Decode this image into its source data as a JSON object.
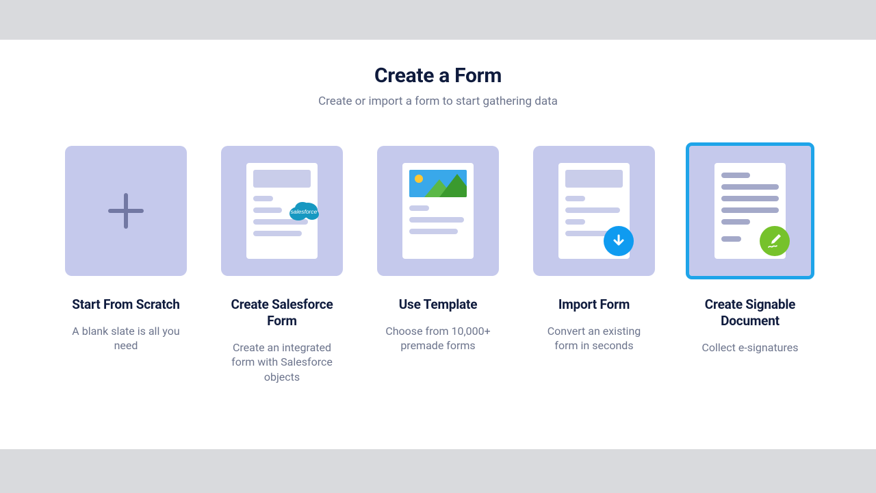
{
  "header": {
    "title": "Create a Form",
    "subtitle": "Create or import a form to start gathering data"
  },
  "options": [
    {
      "key": "scratch",
      "title": "Start From Scratch",
      "description": "A blank slate is all you need",
      "icon": "plus-icon",
      "selected": false
    },
    {
      "key": "salesforce",
      "title": "Create Salesforce Form",
      "description": "Create an integrated form with Salesforce objects",
      "icon": "salesforce-icon",
      "badge_text": "salesforce",
      "selected": false
    },
    {
      "key": "template",
      "title": "Use Template",
      "description": "Choose from 10,000+ premade forms",
      "icon": "image-icon",
      "selected": false
    },
    {
      "key": "import",
      "title": "Import Form",
      "description": "Convert an existing form in seconds",
      "icon": "download-arrow-icon",
      "selected": false
    },
    {
      "key": "signable",
      "title": "Create Signable Document",
      "description": "Collect e-signatures",
      "icon": "pen-signature-icon",
      "selected": true
    }
  ],
  "colors": {
    "tile": "#c5c9ec",
    "accent_selected": "#1ea4e9",
    "download_circle": "#0f9bf0",
    "sign_circle": "#76c22b",
    "salesforce_cloud": "#1798c1",
    "text_heading": "#0f1b3d",
    "text_muted": "#6c748c"
  }
}
